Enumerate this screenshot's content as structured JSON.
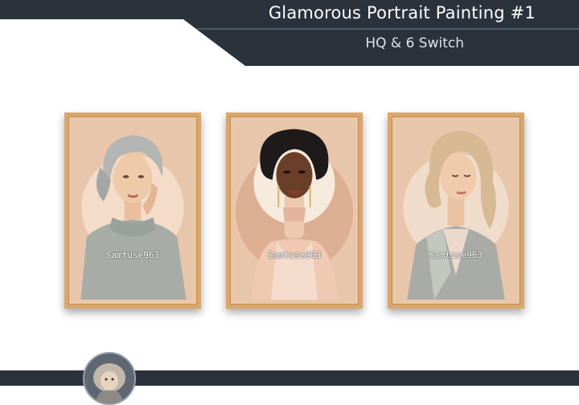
{
  "header": {
    "title": "Glamorous Portrait Painting #1",
    "subtitle": "HQ & 6 Switch"
  },
  "portraits": [
    {
      "watermark": "Samtuse963"
    },
    {
      "watermark": "Samtuse963"
    },
    {
      "watermark": "Samtuse963"
    }
  ],
  "colors": {
    "banner": "#2a323c",
    "frame": "#d9a66c",
    "mat": "#e8c6ab"
  },
  "icons": {
    "avatar": "avatar-icon"
  }
}
